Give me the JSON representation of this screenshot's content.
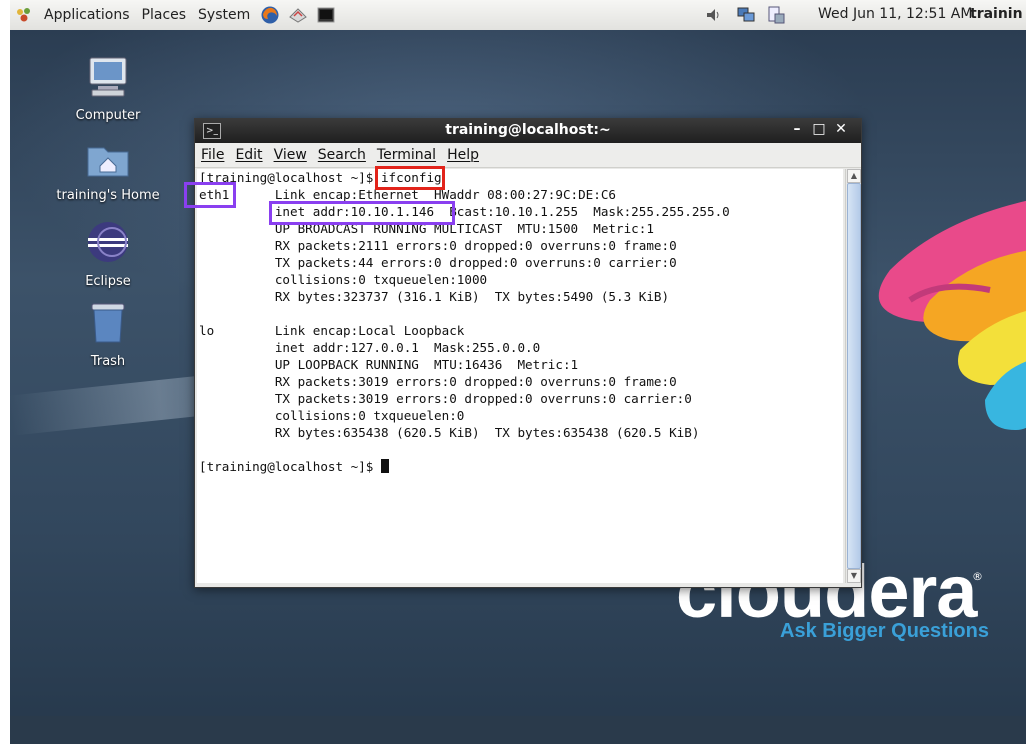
{
  "top_panel": {
    "menus": [
      "Applications",
      "Places",
      "System"
    ],
    "clock": "Wed Jun 11, 12:51 AM",
    "user": "trainin"
  },
  "desktop_icons": [
    {
      "label": "Computer",
      "icon": "computer-icon"
    },
    {
      "label": "training's Home",
      "icon": "home-folder-icon"
    },
    {
      "label": "Eclipse",
      "icon": "eclipse-icon"
    },
    {
      "label": "Trash",
      "icon": "trash-icon"
    }
  ],
  "window": {
    "title": "training@localhost:~",
    "menus": [
      "File",
      "Edit",
      "View",
      "Search",
      "Terminal",
      "Help"
    ]
  },
  "terminal": {
    "lines": [
      "[training@localhost ~]$ ifconfig",
      "eth1      Link encap:Ethernet  HWaddr 08:00:27:9C:DE:C6",
      "          inet addr:10.10.1.146  Bcast:10.10.1.255  Mask:255.255.255.0",
      "          UP BROADCAST RUNNING MULTICAST  MTU:1500  Metric:1",
      "          RX packets:2111 errors:0 dropped:0 overruns:0 frame:0",
      "          TX packets:44 errors:0 dropped:0 overruns:0 carrier:0",
      "          collisions:0 txqueuelen:1000",
      "          RX bytes:323737 (316.1 KiB)  TX bytes:5490 (5.3 KiB)",
      "",
      "lo        Link encap:Local Loopback",
      "          inet addr:127.0.0.1  Mask:255.0.0.0",
      "          UP LOOPBACK RUNNING  MTU:16436  Metric:1",
      "          RX packets:3019 errors:0 dropped:0 overruns:0 frame:0",
      "          TX packets:3019 errors:0 dropped:0 overruns:0 carrier:0",
      "          collisions:0 txqueuelen:0",
      "          RX bytes:635438 (620.5 KiB)  TX bytes:635438 (620.5 KiB)",
      "",
      "[training@localhost ~]$ "
    ]
  },
  "branding": {
    "logo": "cloudera",
    "registered": "®",
    "tagline": "Ask Bigger Questions"
  },
  "colors": {
    "highlight_red": "#e2241b",
    "highlight_purple": "#8a3ff0",
    "tagline_blue": "#3aa0d8"
  }
}
